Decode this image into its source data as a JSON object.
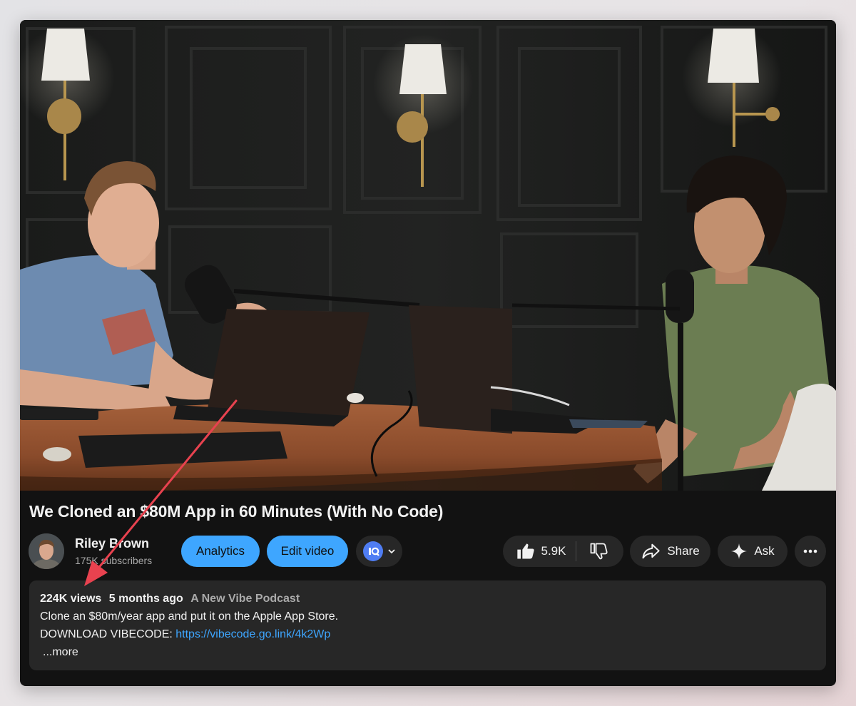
{
  "video": {
    "title": "We Cloned an $80M App in 60 Minutes (With No Code)"
  },
  "channel": {
    "name": "Riley Brown",
    "subscribers": "175K subscribers"
  },
  "actions": {
    "analytics_label": "Analytics",
    "edit_label": "Edit video",
    "like_count": "5.9K",
    "share_label": "Share",
    "ask_label": "Ask"
  },
  "description": {
    "views": "224K views",
    "age": "5 months ago",
    "hashtag": "A New Vibe Podcast",
    "line1": "Clone an $80m/year app and put it on the Apple App Store.",
    "line2_prefix": "DOWNLOAD VIBECODE: ",
    "line2_link": "https://vibecode.go.link/4k2Wp",
    "more_label": "...more"
  },
  "icons": {
    "like": "thumbs-up-icon",
    "dislike": "thumbs-down-icon",
    "share": "share-arrow-icon",
    "ask": "sparkle-icon",
    "more": "ellipsis-icon",
    "extension": "extension-logo-icon",
    "chevron": "chevron-down-icon"
  },
  "colors": {
    "accent_blue": "#3ea6ff",
    "annotation_arrow": "#e8424f",
    "surface": "#272727",
    "background": "#121212"
  }
}
